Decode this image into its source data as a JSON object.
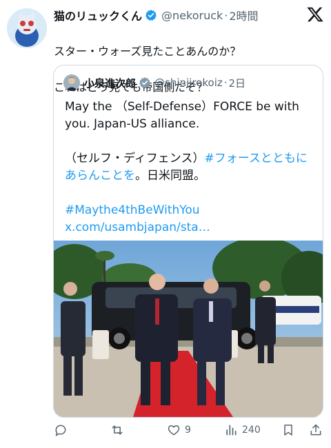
{
  "tweet": {
    "author_name": "猫のリュックくん",
    "author_handle": "@nekoruck",
    "dot": "·",
    "time": "2時間",
    "text_line1": "スター・ウォーズ見たことあんのか？",
    "text_line2": "これはどう見ても帝国側だぞ？"
  },
  "quote": {
    "author_name": "小泉進次郎",
    "author_handle": "@shinjirokoiz",
    "dot": "·",
    "time": "2日",
    "text_en": "May the （Self-Defense）FORCE be with you. Japan-US alliance.",
    "text_ja_prefix": "（セルフ・ディフェンス）",
    "text_ja_hashtag": "#フォースとともにあらんことを",
    "text_ja_suffix": "。日米同盟。",
    "hashtag": "#Maythe4thBeWithYou",
    "link_text": "x.com/usambjapan/sta…"
  },
  "actions": {
    "reply_count": "",
    "retweet_count": "",
    "like_count": "9",
    "views_count": "240"
  },
  "colors": {
    "link": "#1d9bf0",
    "verified": "#1d9bf0",
    "muted": "#536471"
  }
}
